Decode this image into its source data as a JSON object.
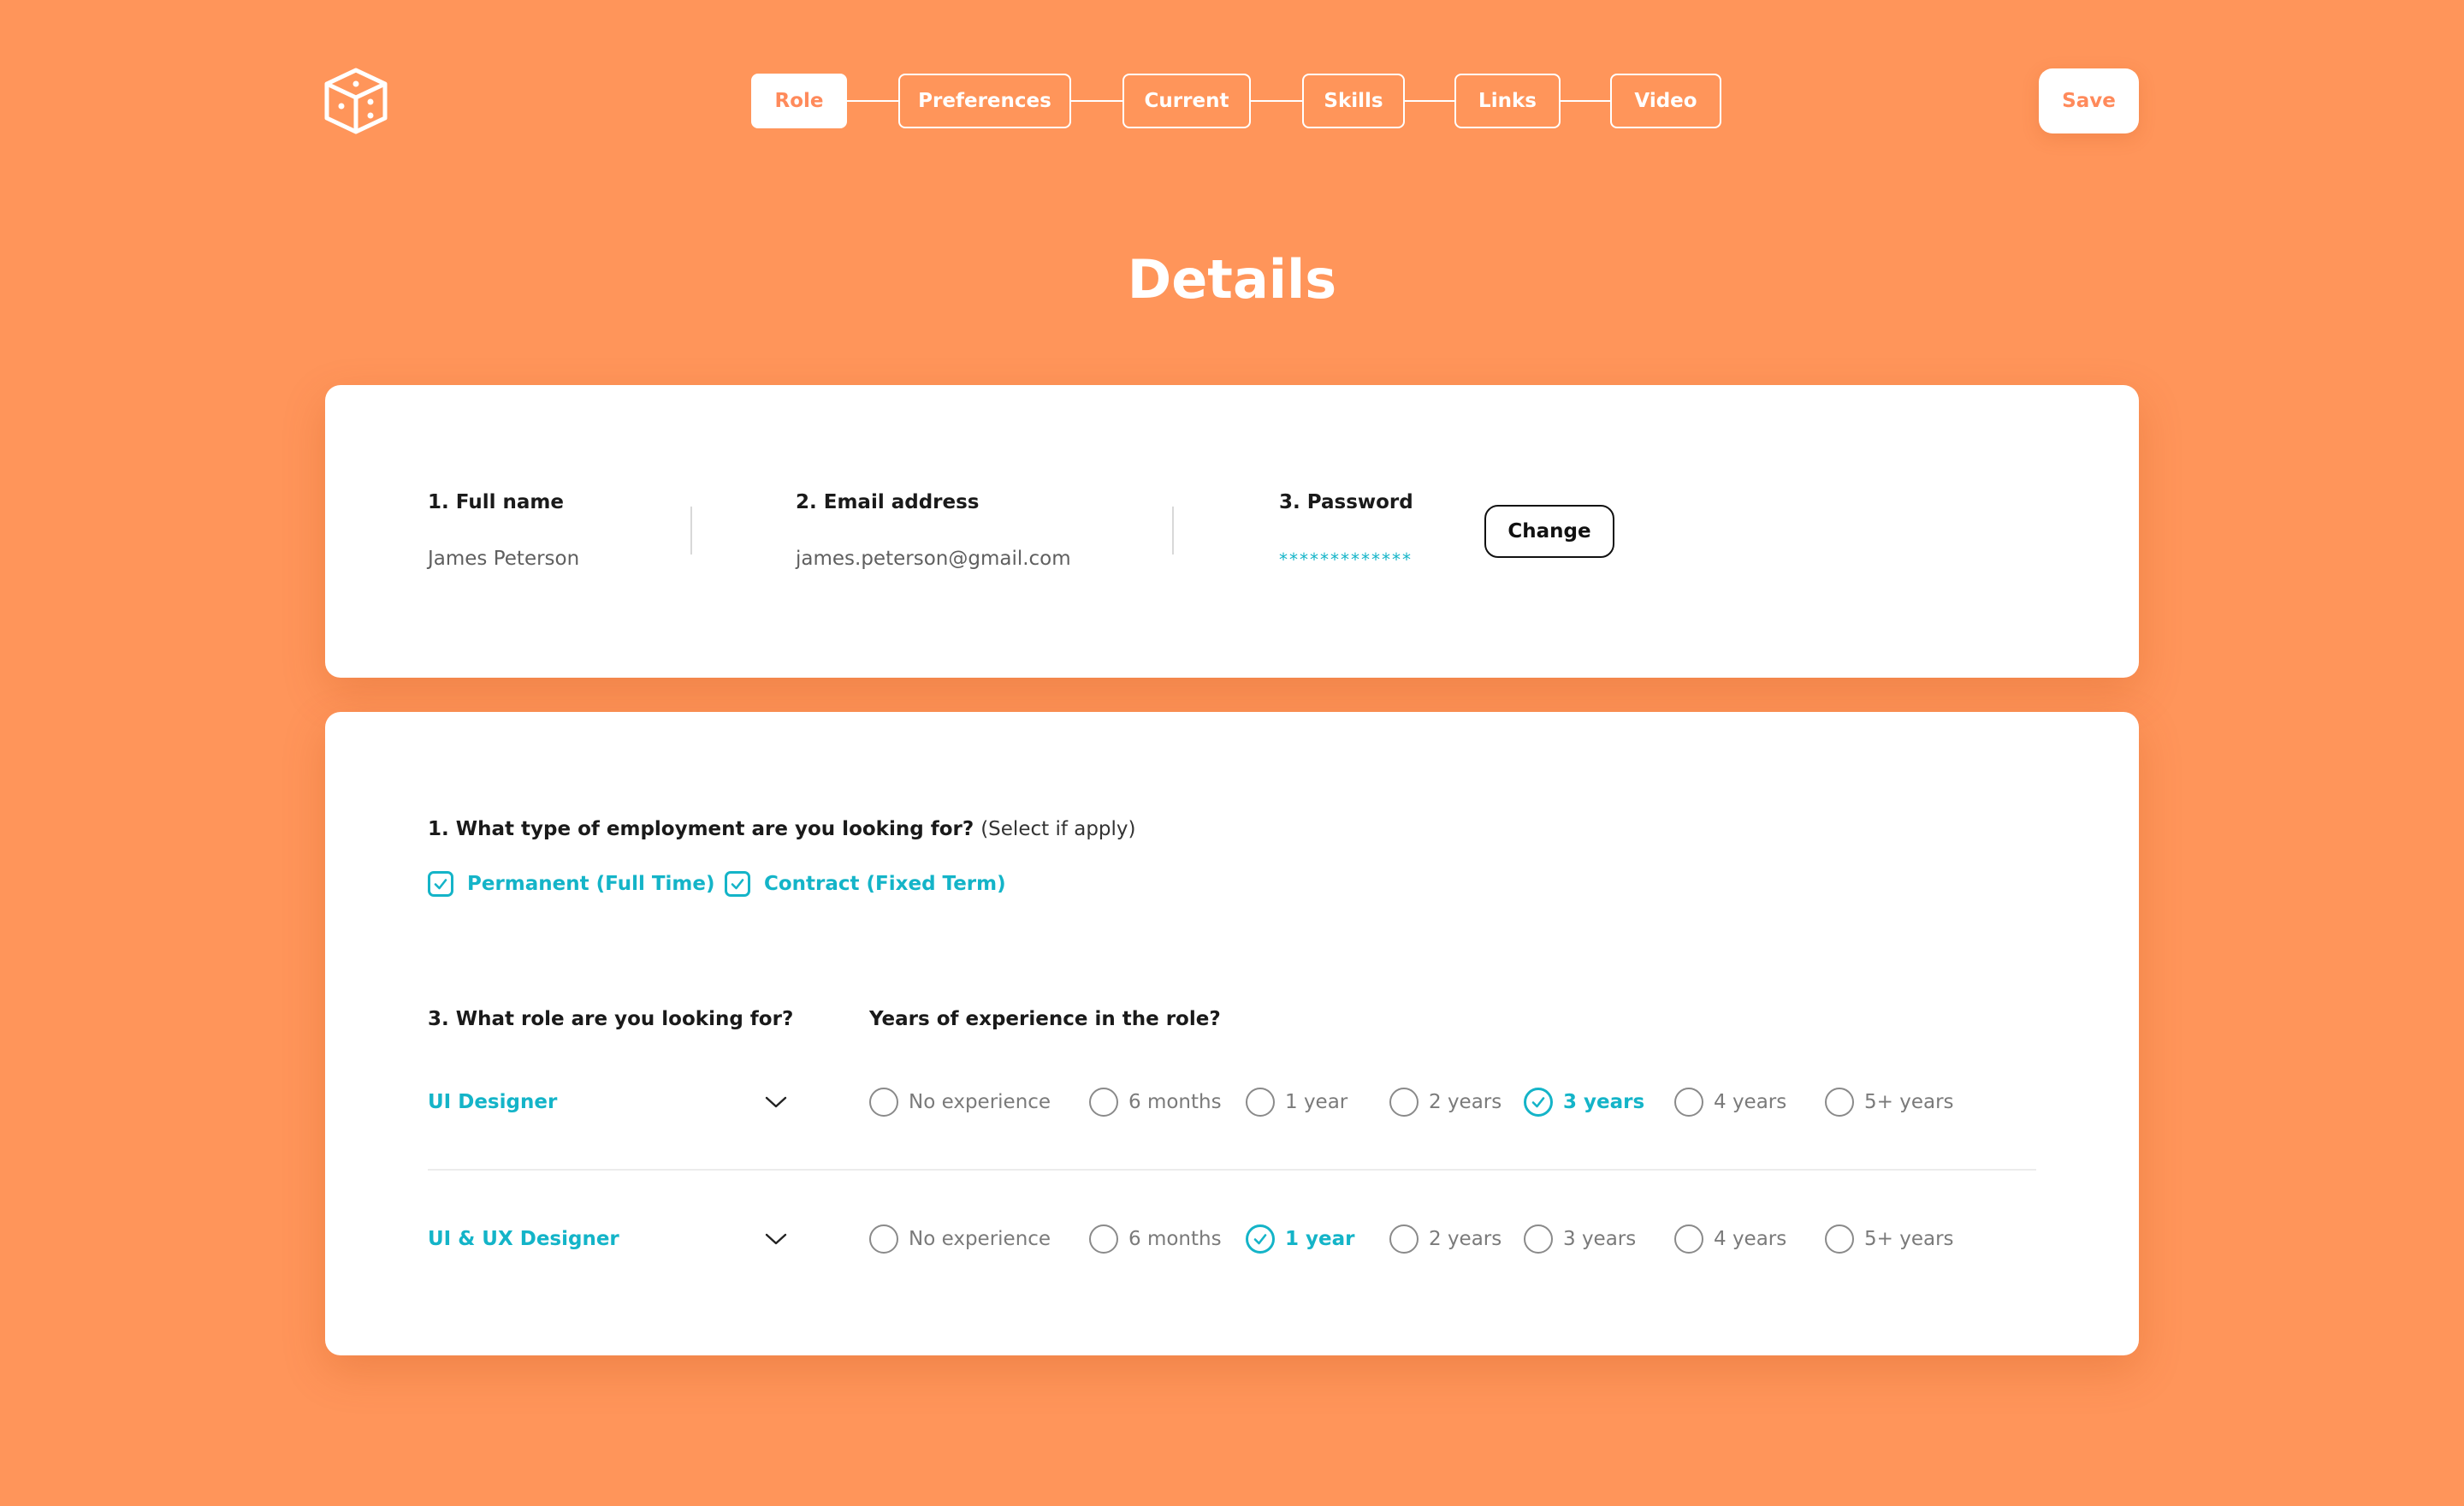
{
  "header": {
    "logo_icon": "dice-cube-icon",
    "steps": [
      {
        "label": "Role",
        "active": true
      },
      {
        "label": "Preferences",
        "active": false
      },
      {
        "label": "Current",
        "active": false
      },
      {
        "label": "Skills",
        "active": false
      },
      {
        "label": "Links",
        "active": false
      },
      {
        "label": "Video",
        "active": false
      }
    ],
    "save_label": "Save"
  },
  "page_title": "Details",
  "account": {
    "full_name_label": "1. Full name",
    "full_name_value": "James Peterson",
    "email_label": "2. Email address",
    "email_value": "james.peterson@gmail.com",
    "password_label": "3. Password",
    "password_value": "*************",
    "change_label": "Change"
  },
  "employment": {
    "question": "1. What type of employment are you looking for?",
    "hint": "(Select if apply)",
    "options": [
      {
        "label": "Permanent (Full Time)",
        "checked": true
      },
      {
        "label": "Contract (Fixed Term)",
        "checked": true
      }
    ]
  },
  "roles": {
    "question": "3. What role are you looking for?",
    "experience_question": "Years of experience in the role?",
    "experience_options": [
      "No experience",
      "6 months",
      "1 year",
      "2 years",
      "3 years",
      "4 years",
      "5+ years"
    ],
    "rows": [
      {
        "role": "UI Designer",
        "selected_experience": "3 years"
      },
      {
        "role": "UI & UX Designer",
        "selected_experience": "1 year"
      }
    ]
  },
  "colors": {
    "background": "#FF955A",
    "accent": "#14B4C8",
    "brand": "#FF8A5B"
  }
}
